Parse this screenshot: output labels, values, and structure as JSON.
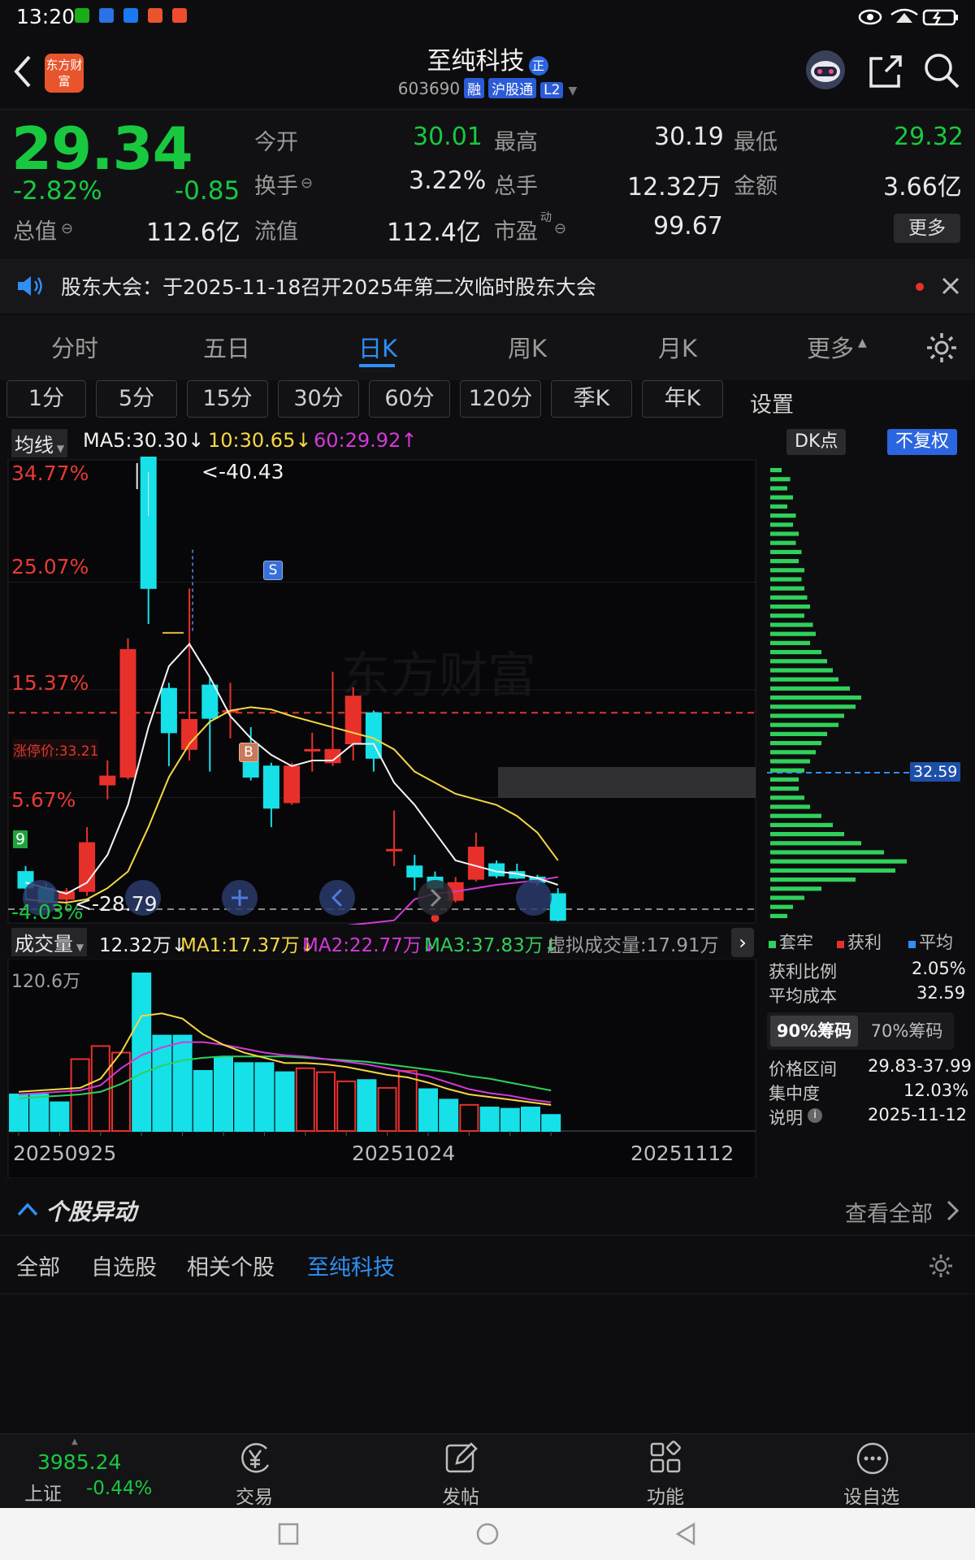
{
  "status_bar": {
    "time": "13:20"
  },
  "header": {
    "title": "至纯科技",
    "title_badge": "正",
    "code": "603690",
    "tags": [
      "融",
      "沪股通",
      "L2"
    ],
    "logo_text": "东方财富"
  },
  "quote": {
    "price": "29.34",
    "change_pct": "-2.82%",
    "change_amt": "-0.85",
    "open_label": "今开",
    "open": "30.01",
    "high_label": "最高",
    "high": "30.19",
    "low_label": "最低",
    "low": "29.32",
    "turnover_label": "换手",
    "turnover": "3.22%",
    "volume_label": "总手",
    "volume": "12.32万",
    "amount_label": "金额",
    "amount": "3.66亿",
    "total_value_label": "总值",
    "total_value": "112.6亿",
    "float_value_label": "流值",
    "float_value": "112.4亿",
    "pe_label": "市盈",
    "pe_sup": "动",
    "pe": "99.67",
    "more_label": "更多"
  },
  "notice": {
    "text": "股东大会：于2025-11-18召开2025年第二次临时股东大会"
  },
  "tabs": [
    "分时",
    "五日",
    "日K",
    "周K",
    "月K",
    "更多"
  ],
  "active_tab": "日K",
  "periods": [
    "1分",
    "5分",
    "15分",
    "30分",
    "60分",
    "120分",
    "季K",
    "年K"
  ],
  "periods_settings": "设置",
  "ma_legend": {
    "selector": "均线",
    "ma5": "MA5:30.30↓",
    "ma10": "10:30.65↓",
    "ma60": "60:29.92↑",
    "dk_label": "DK点",
    "adjust_label": "不复权"
  },
  "price_axis": [
    "34.77%",
    "25.07%",
    "15.37%",
    "5.67%",
    "-4.03%"
  ],
  "limit_label": "涨停价:33.21",
  "high_marker": "<-40.43",
  "low_marker": "<-28.79",
  "signals": {
    "sell": "S",
    "buy": "B"
  },
  "marker_9": "9",
  "volume_legend": {
    "selector": "成交量",
    "vol": "12.32万↓",
    "ma1": "MA1:17.37万↓",
    "ma2": "MA2:22.77万↓",
    "ma3": "MA3:37.83万↓",
    "virtual": "虚拟成交量:17.91万"
  },
  "volume_axis_max": "120.6万",
  "date_labels": [
    "20250925",
    "20251024",
    "20251112"
  ],
  "chips_panel": {
    "legend": [
      "套牢",
      "获利",
      "平均"
    ],
    "avg_cost_tag": "32.59",
    "profit_ratio_label": "获利比例",
    "profit_ratio": "2.05%",
    "avg_cost_label": "平均成本",
    "avg_cost": "32.59",
    "tab_90": "90%筹码",
    "tab_70": "70%筹码",
    "price_range_label": "价格区间",
    "price_range": "29.83-37.99",
    "concentration_label": "集中度",
    "concentration": "12.03%",
    "note_label": "说明",
    "note_date": "2025-11-12"
  },
  "movement": {
    "title": "个股异动",
    "view_all": "查看全部",
    "filters": [
      "全部",
      "自选股",
      "相关个股",
      "至纯科技"
    ]
  },
  "bottom_nav": {
    "index_value": "3985.24",
    "index_name": "上证",
    "index_change": "-0.44%",
    "items": [
      "交易",
      "发帖",
      "功能",
      "设自选"
    ]
  },
  "chart_data": {
    "type": "candlestick",
    "candles": [
      {
        "o": -1.0,
        "c": -2.5,
        "h": -0.5,
        "l": -3.5,
        "up": false
      },
      {
        "o": -2.5,
        "c": -3.8,
        "h": -2.0,
        "l": -4.0,
        "up": false
      },
      {
        "o": -3.5,
        "c": -2.8,
        "h": -2.5,
        "l": -4.3,
        "up": true
      },
      {
        "o": -2.8,
        "c": 1.6,
        "h": 3.0,
        "l": -3.2,
        "up": true
      },
      {
        "o": 6.8,
        "c": 7.6,
        "h": 9.0,
        "l": 5.5,
        "up": true
      },
      {
        "o": 7.5,
        "c": 19.0,
        "h": 20.0,
        "l": 7.3,
        "up": true
      },
      {
        "o": 39.8,
        "c": 24.5,
        "h": 41.0,
        "l": 21.3,
        "up": false
      },
      {
        "o": 15.5,
        "c": 11.5,
        "h": 16.0,
        "l": 8.5,
        "up": false
      },
      {
        "o": 10.0,
        "c": 12.7,
        "h": 24.5,
        "l": 9.0,
        "up": true
      },
      {
        "o": 15.8,
        "c": 12.8,
        "h": 16.5,
        "l": 8.0,
        "up": false
      },
      {
        "o": 13.5,
        "c": 13.5,
        "h": 16.0,
        "l": 11.0,
        "up": true
      },
      {
        "o": 10.5,
        "c": 7.5,
        "h": 12.0,
        "l": 7.2,
        "up": false
      },
      {
        "o": 8.5,
        "c": 4.7,
        "h": 8.8,
        "l": 3.0,
        "up": false
      },
      {
        "o": 5.2,
        "c": 8.5,
        "h": 8.8,
        "l": 5.0,
        "up": true
      },
      {
        "o": 10.0,
        "c": 10.0,
        "h": 11.5,
        "l": 8.0,
        "up": true
      },
      {
        "o": 8.8,
        "c": 10.0,
        "h": 17.0,
        "l": 8.5,
        "up": true
      },
      {
        "o": 10.5,
        "c": 14.8,
        "h": 15.6,
        "l": 9.0,
        "up": true
      },
      {
        "o": 13.3,
        "c": 9.2,
        "h": 13.5,
        "l": 8.0,
        "up": false
      },
      {
        "o": 1.0,
        "c": 1.0,
        "h": 4.5,
        "l": -0.5,
        "up": true
      },
      {
        "o": -0.5,
        "c": -1.5,
        "h": 0.5,
        "l": -2.7,
        "up": false
      },
      {
        "o": -1.5,
        "c": -2.5,
        "h": -1.0,
        "l": -3.0,
        "up": false
      },
      {
        "o": -3.6,
        "c": -2.0,
        "h": -1.5,
        "l": -3.8,
        "up": true
      },
      {
        "o": 1.2,
        "c": -1.7,
        "h": 2.5,
        "l": -1.9,
        "up": true
      },
      {
        "o": -0.3,
        "c": -1.4,
        "h": 0.0,
        "l": -1.6,
        "up": false
      },
      {
        "o": -1.0,
        "c": -1.6,
        "h": -0.3,
        "l": -1.7,
        "up": false
      },
      {
        "o": -1.5,
        "c": -2.0,
        "h": -1.3,
        "l": -2.3,
        "up": false
      },
      {
        "o": -3.0,
        "c": -5.4,
        "h": -2.5,
        "l": -5.5,
        "up": false
      }
    ],
    "ma5": [
      -2.0,
      -2.5,
      -3.0,
      -2.0,
      0.5,
      5.0,
      12.0,
      17.5,
      19.5,
      16.5,
      13.0,
      11.0,
      9.5,
      8.5,
      9.0,
      9.0,
      10.5,
      10.5,
      7.0,
      5.0,
      2.5,
      0.0,
      -0.5,
      -1.0,
      -1.2,
      -1.6,
      -2.2
    ],
    "ma10": [
      -3.5,
      -3.7,
      -3.8,
      -3.5,
      -2.5,
      -1.0,
      3.0,
      7.5,
      10.5,
      12.5,
      13.5,
      13.8,
      13.6,
      13.0,
      12.5,
      12.0,
      11.5,
      11.0,
      10.0,
      8.0,
      7.0,
      6.0,
      5.5,
      5.0,
      4.0,
      2.5,
      0.0
    ],
    "ma60": [
      -9.0,
      -8.8,
      -8.6,
      -8.4,
      -8.2,
      -8.0,
      -7.8,
      -7.6,
      -7.4,
      -7.2,
      -7.0,
      -6.8,
      -6.6,
      -6.4,
      -6.2,
      -6.0,
      -5.8,
      -5.6,
      -5.4,
      -3.5,
      -3.0,
      -2.8,
      -2.5,
      -2.2,
      -2.0,
      -1.8,
      -1.5
    ],
    "volumes": [
      28,
      28,
      22,
      55,
      65,
      60,
      120.6,
      73,
      73,
      46,
      56,
      52,
      52,
      45,
      48,
      45,
      38,
      39,
      33,
      46,
      32,
      24,
      20,
      18,
      17,
      18,
      12.3
    ],
    "volume_up": [
      false,
      false,
      false,
      true,
      true,
      true,
      false,
      false,
      false,
      false,
      false,
      false,
      false,
      false,
      true,
      true,
      true,
      false,
      true,
      true,
      false,
      false,
      true,
      false,
      false,
      false,
      false
    ],
    "vma1": [
      30,
      31,
      32,
      33,
      40,
      60,
      88,
      90,
      86,
      74,
      66,
      60,
      56,
      52,
      52,
      51,
      49,
      46,
      43,
      41,
      37,
      32,
      28,
      26,
      24,
      22,
      20
    ],
    "vma2": [
      28,
      29,
      30,
      31,
      35,
      48,
      58,
      64,
      68,
      68,
      66,
      63,
      60,
      58,
      57,
      55,
      53,
      51,
      48,
      45,
      42,
      37,
      32,
      29,
      27,
      24,
      22
    ],
    "vma3": [
      25,
      26,
      27,
      28,
      30,
      36,
      44,
      50,
      54,
      56,
      57,
      57,
      57,
      57,
      56,
      55,
      54,
      53,
      51,
      49,
      47,
      45,
      42,
      40,
      37,
      34,
      31
    ],
    "y_range_pct": [
      -4.03,
      34.77
    ],
    "limit_pct": 13.3,
    "volume_max": 120.6,
    "chip_rows": [
      0.2,
      0.35,
      0.3,
      0.4,
      0.3,
      0.45,
      0.4,
      0.5,
      0.45,
      0.55,
      0.5,
      0.6,
      0.55,
      0.6,
      0.65,
      0.7,
      0.6,
      0.75,
      0.8,
      0.7,
      0.9,
      1.0,
      1.1,
      1.2,
      1.4,
      1.6,
      1.5,
      1.3,
      1.2,
      1.0,
      0.9,
      0.8,
      0.7,
      0.6,
      0.5,
      0.5,
      0.6,
      0.7,
      0.9,
      1.1,
      1.3,
      1.6,
      2.0,
      2.4,
      2.2,
      1.5,
      0.9,
      0.6,
      0.4,
      0.3
    ]
  }
}
